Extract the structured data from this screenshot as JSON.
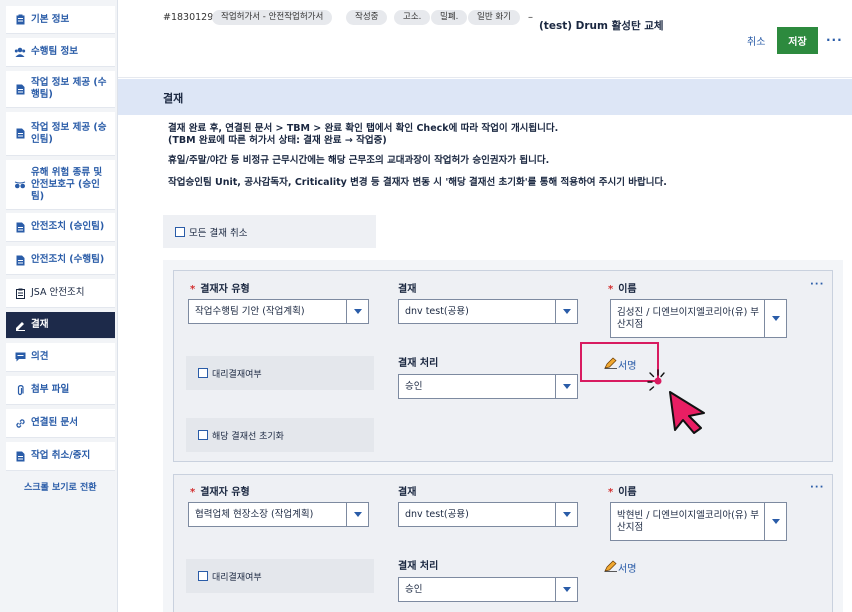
{
  "sidebar": {
    "items": [
      {
        "label": "기본 정보",
        "icon": "clipboard-icon"
      },
      {
        "label": "수행팀 정보",
        "icon": "team-icon"
      },
      {
        "label": "작업 정보 제공 (수행팀)",
        "icon": "document-icon"
      },
      {
        "label": "작업 정보 제공 (승인팀)",
        "icon": "document-icon"
      },
      {
        "label": "유해 위험 종류 및 안전보호구 (승인팀)",
        "icon": "goggles-icon"
      },
      {
        "label": "안전조치 (승인팀)",
        "icon": "document-icon"
      },
      {
        "label": "안전조치 (수행팀)",
        "icon": "document-icon"
      },
      {
        "label": "JSA 안전조치",
        "icon": "clipboard-icon"
      },
      {
        "label": "결재",
        "icon": "pen-icon"
      },
      {
        "label": "의견",
        "icon": "comment-icon"
      },
      {
        "label": "첨부 파일",
        "icon": "paperclip-icon"
      },
      {
        "label": "연결된 문서",
        "icon": "link-icon"
      },
      {
        "label": "작업 취소/중지",
        "icon": "document-icon"
      }
    ],
    "scroll_view_label": "스크롤 보기로 전환"
  },
  "header": {
    "request_no": "#1830129",
    "tags": [
      "작업허가서 - 안전작업허가서",
      "작성중",
      "고소.",
      "밀폐.",
      "일반 화기"
    ],
    "dash": "–",
    "title": "(test) Drum 활성탄 교체",
    "cancel_label": "취소",
    "save_label": "저장",
    "more_label": "···"
  },
  "section": {
    "title": "결재"
  },
  "notices": {
    "line1": "결재 완료 후, 연결된 문서 > TBM > 완료 확인 탭에서 확인 Check에 따라 작업이 개시됩니다.",
    "line2": "(TBM 완료에 따른 허가서 상태: 결재 완료 → 작업중)",
    "line3": "휴일/주말/야간 등 비정규 근무시간에는 해당 근무조의 교대과장이 작업허가 승인권자가 됩니다.",
    "line4": "작업승인팀 Unit, 공사감독자, Criticality 변경 등 결재자 변동 시 '해당 결재선 초기화'를 통해 적용하여 주시기 바랍니다."
  },
  "cancel_all_label": "모든 결재 취소",
  "labels": {
    "approver_type": "결재자 유형",
    "approval": "결재",
    "name": "이름",
    "process": "결재 처리",
    "proxy": "대리결재여부",
    "reset": "해당 결재선 초기화",
    "sign": "서명",
    "required": "*",
    "card_more": "···"
  },
  "approvers": [
    {
      "type": "작업수행팀 기안 (작업계획)",
      "approval": "dnv test(공용)",
      "name": "김성진 / 디엔브이지엘코리아(유) 부산지점",
      "process": "승인"
    },
    {
      "type": "협력업체 현장소장 (작업계획)",
      "approval": "dnv test(공용)",
      "name": "박현빈 / 디엔브이지엘코리아(유) 부산지점",
      "process": "승인"
    }
  ],
  "colors": {
    "accent": "#2a5ca8",
    "save_button": "#2d8a3e",
    "active_nav": "#1d2a4a",
    "highlight": "#d81b60"
  }
}
